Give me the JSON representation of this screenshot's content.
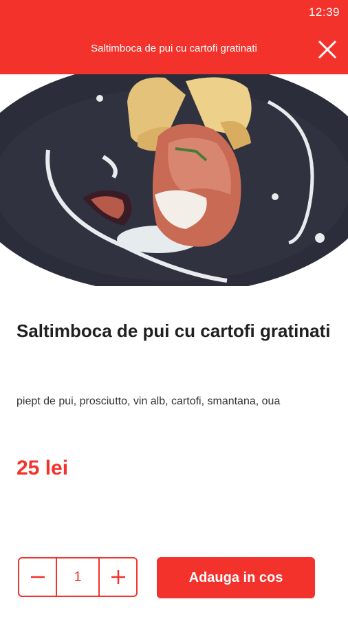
{
  "status_bar": {
    "time": "12:39"
  },
  "app_bar": {
    "title": "Saltimboca de pui cu cartofi gratinati"
  },
  "product": {
    "name": "Saltimboca de pui cu cartofi gratinati",
    "ingredients": "piept de pui, prosciutto, vin alb, cartofi, smantana, oua",
    "price": "25 lei"
  },
  "cart": {
    "quantity": "1",
    "add_button_label": "Adauga in cos"
  },
  "colors": {
    "accent": "#f4322c",
    "text": "#202020"
  },
  "icons": {
    "close": "close-icon",
    "minus": "minus-icon",
    "plus": "plus-icon"
  }
}
